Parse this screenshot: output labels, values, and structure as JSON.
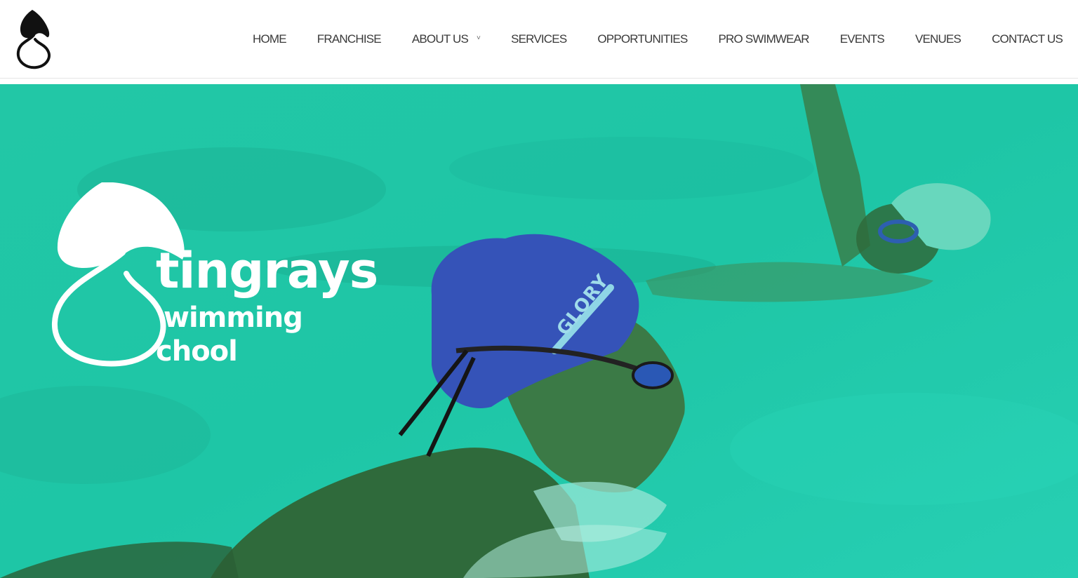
{
  "header": {
    "logo_icon": "stingray-s-logo-icon",
    "nav": [
      {
        "label": "HOME",
        "has_dropdown": false
      },
      {
        "label": "FRANCHISE",
        "has_dropdown": false
      },
      {
        "label": "ABOUT US",
        "has_dropdown": true
      },
      {
        "label": "SERVICES",
        "has_dropdown": false
      },
      {
        "label": "OPPORTUNITIES",
        "has_dropdown": false
      },
      {
        "label": "PRO SWIMWEAR",
        "has_dropdown": false
      },
      {
        "label": "EVENTS",
        "has_dropdown": false
      },
      {
        "label": "VENUES",
        "has_dropdown": false
      },
      {
        "label": "CONTACT US",
        "has_dropdown": false
      }
    ],
    "dropdown_glyph": "˅"
  },
  "hero": {
    "brand": {
      "line1": "tingrays",
      "line2": "wimming",
      "line3": "chool"
    },
    "cap_text": "GLORY",
    "overlay_color": "#1fc9a8"
  }
}
